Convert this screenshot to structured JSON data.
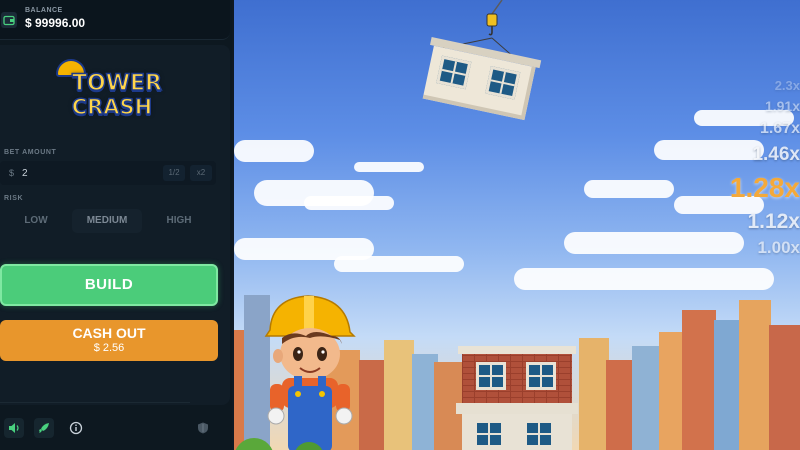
{
  "balance": {
    "label": "BALANCE",
    "value": "$ 99996.00",
    "icon": "wallet-icon"
  },
  "logo": {
    "line1": "TOWER",
    "line2": "CRASH"
  },
  "bet": {
    "label": "BET AMOUNT",
    "currency": "$",
    "value": "2",
    "half_label": "1/2",
    "double_label": "x2"
  },
  "risk": {
    "label": "RISK",
    "options": [
      "LOW",
      "MEDIUM",
      "HIGH"
    ],
    "selected": "MEDIUM"
  },
  "actions": {
    "build_label": "BUILD",
    "cashout_label": "CASH OUT",
    "cashout_amount": "$ 2.56"
  },
  "footer": {
    "icons": [
      "sound-icon",
      "rocket-icon",
      "info-icon",
      "shield-icon"
    ]
  },
  "multipliers": {
    "values": [
      "2.3x",
      "1.91x",
      "1.67x",
      "1.46x",
      "1.28x",
      "1.12x",
      "1.00x"
    ],
    "current": "1.28x"
  },
  "colors": {
    "build": "#4bcc7a",
    "cashout": "#e8962c",
    "current_multiplier": "#f4a93a",
    "sidebar": "#111d27"
  }
}
